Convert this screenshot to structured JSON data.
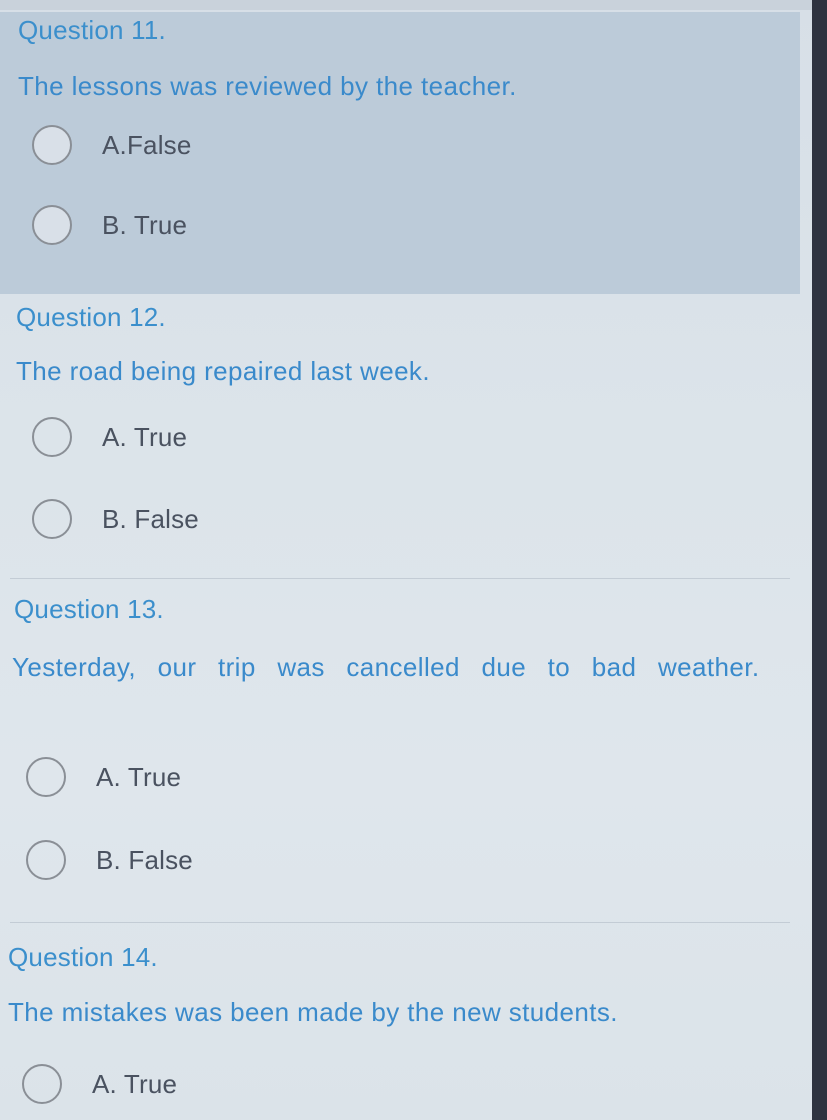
{
  "questions": [
    {
      "title": "Question 11.",
      "text": "The lessons was reviewed by the teacher.",
      "options": [
        {
          "label": "A.False",
          "selected": false
        },
        {
          "label": "B. True",
          "selected": false
        }
      ],
      "highlighted": true
    },
    {
      "title": "Question 12.",
      "text": "The road being repaired last week.",
      "options": [
        {
          "label": "A. True",
          "selected": false
        },
        {
          "label": "B. False",
          "selected": false
        }
      ],
      "highlighted": false
    },
    {
      "title": "Question 13.",
      "text": "Yesterday, our trip was cancelled due to bad weather.",
      "options": [
        {
          "label": "A. True",
          "selected": false
        },
        {
          "label": "B. False",
          "selected": false
        }
      ],
      "highlighted": false
    },
    {
      "title": "Question 14.",
      "text": "The mistakes was been made by the new students.",
      "options": [
        {
          "label": "A. True",
          "selected": false
        }
      ],
      "highlighted": false
    }
  ],
  "colors": {
    "question_text": "#3a8acb",
    "option_text": "#4a5260",
    "highlight_bg": "#bccbd9",
    "page_bg": "#dce4ea"
  }
}
